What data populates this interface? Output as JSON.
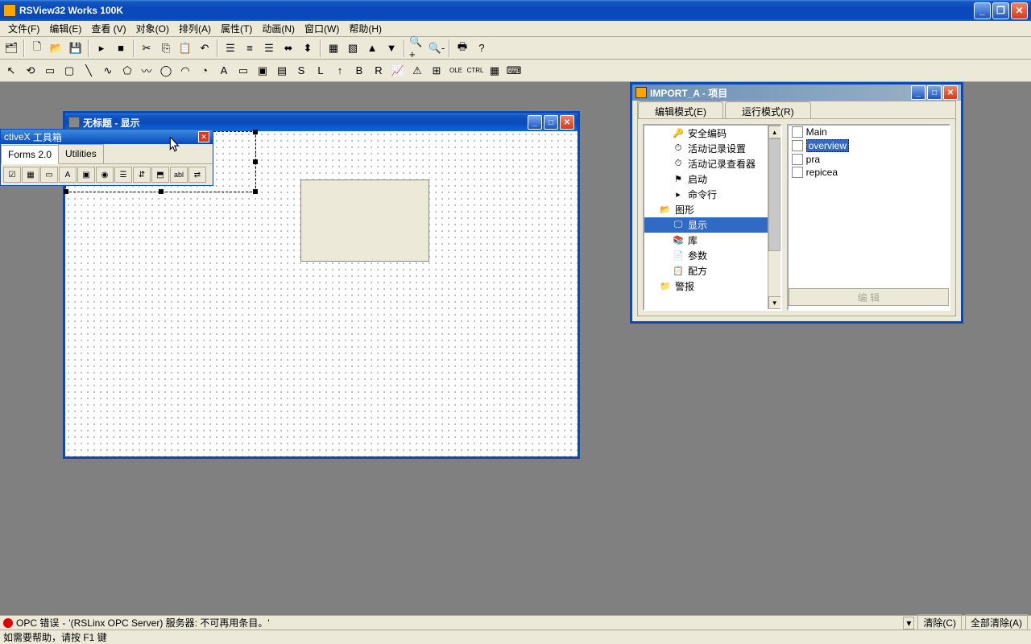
{
  "app": {
    "title": "RSView32 Works 100K"
  },
  "menu": {
    "file": "文件(F)",
    "edit": "编辑(E)",
    "view": "查看 (V)",
    "object": "对象(O)",
    "arrange": "排列(A)",
    "attr": "属性(T)",
    "anim": "动画(N)",
    "window": "窗口(W)",
    "help": "帮助(H)"
  },
  "display_window": {
    "title": "无标题 - 显示"
  },
  "toolbox": {
    "title_left": "ctiveX",
    "title_right": "工具箱",
    "tabs": {
      "forms": "Forms 2.0",
      "utilities": "Utilities"
    }
  },
  "project_window": {
    "title": "IMPORT_A - 项目",
    "tabs": {
      "edit_mode": "编辑模式(E)",
      "run_mode": "运行模式(R)"
    },
    "tree": {
      "security": "安全编码",
      "activity_setup": "活动记录设置",
      "activity_viewer": "活动记录查看器",
      "startup": "启动",
      "cmdline": "命令行",
      "graphics": "图形",
      "display": "显示",
      "library": "库",
      "params": "参数",
      "recipe": "配方",
      "alarm": "警报"
    },
    "list": {
      "main": "Main",
      "overview": "overview",
      "pra": "pra",
      "repicea": "repicea"
    },
    "edit_btn": "编 辑"
  },
  "error_bar": {
    "label": "OPC 错误",
    "msg": "'(RSLinx OPC Server) 服务器: 不可再用条目。'",
    "clear": "清除(C)",
    "clear_all": "全部清除(A)"
  },
  "status_bar": {
    "help": "如需要帮助，请按 F1 键"
  }
}
